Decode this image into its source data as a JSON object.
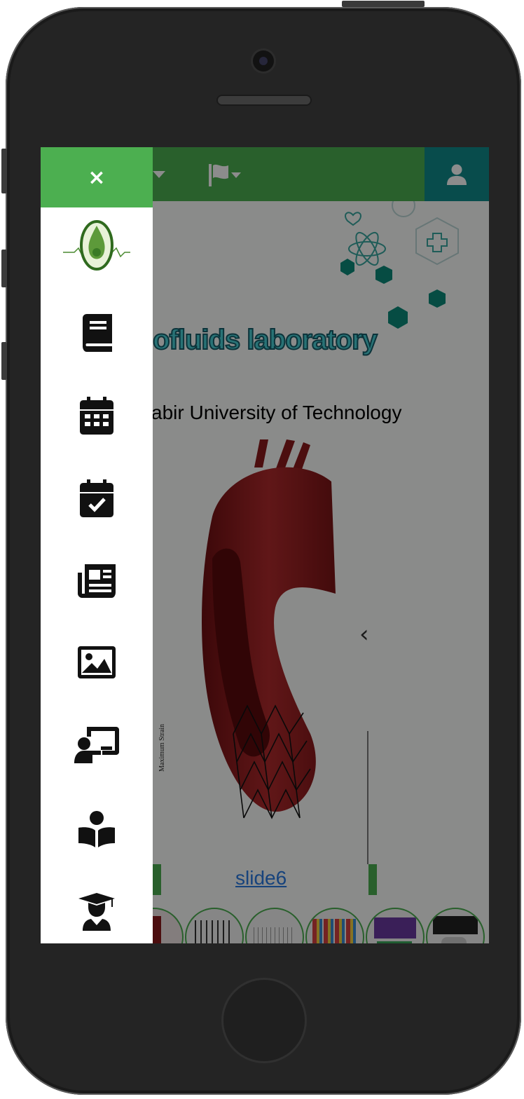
{
  "header": {
    "flag_icon": "flag-icon",
    "user_icon": "user-icon"
  },
  "hero": {
    "title": "iofluids laboratory",
    "subtitle": "abir University of Technology"
  },
  "slider": {
    "current_label": "slide6",
    "axis_label": "Maximum Strain"
  },
  "drawer": {
    "close_label": "×",
    "items": [
      {
        "icon": "book-icon"
      },
      {
        "icon": "calendar-grid-icon"
      },
      {
        "icon": "calendar-check-icon"
      },
      {
        "icon": "newspaper-icon"
      },
      {
        "icon": "image-icon"
      },
      {
        "icon": "teacher-presentation-icon"
      },
      {
        "icon": "reader-icon"
      },
      {
        "icon": "graduate-icon"
      }
    ]
  },
  "colors": {
    "accent": "#4caf50",
    "accent_dark": "#2c6a2c",
    "teal": "#0f8a8a",
    "title_fill": "#4ad0d6",
    "link": "#2a7ae2"
  }
}
